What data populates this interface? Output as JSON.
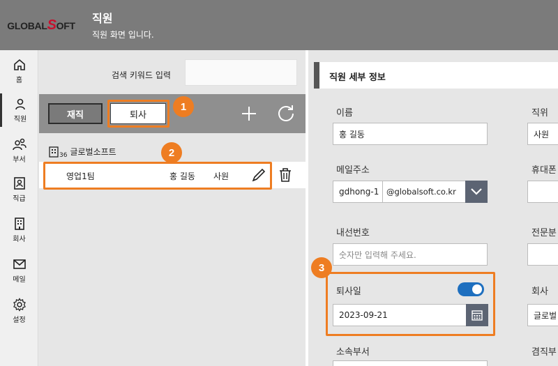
{
  "header": {
    "logo_part1": "GLOBAL",
    "logo_part2": "S",
    "logo_part3": "OFT",
    "title": "직원",
    "subtitle": "직원 화면 입니다."
  },
  "nav": {
    "items": [
      {
        "label": "홈",
        "icon": "home-icon"
      },
      {
        "label": "직원",
        "icon": "person-icon"
      },
      {
        "label": "부서",
        "icon": "people-icon"
      },
      {
        "label": "직급",
        "icon": "badge-icon"
      },
      {
        "label": "회사",
        "icon": "building-icon"
      },
      {
        "label": "메일",
        "icon": "mail-icon"
      },
      {
        "label": "설정",
        "icon": "gear-icon"
      }
    ],
    "active_index": 1
  },
  "list": {
    "search_label": "검색 키워드 입력",
    "search_value": "",
    "tab_active": "재직",
    "tab_inactive": "퇴사",
    "org": {
      "name": "글로벌소프트",
      "count": "36"
    },
    "employee": {
      "team": "영업1팀",
      "name": "홍 길동",
      "rank": "사원"
    }
  },
  "detail": {
    "title": "직원 세부 정보",
    "name_label": "이름",
    "name_value": "홍 길동",
    "position_label": "직위",
    "position_value": "사원",
    "email_label": "메일주소",
    "email_id": "gdhong-1",
    "email_domain": "@globalsoft.co.kr",
    "phone_label": "휴대폰",
    "ext_label": "내선번호",
    "ext_placeholder": "숫자만 입력해 주세요.",
    "specialty_label": "전문분",
    "retire_label": "퇴사일",
    "retire_toggle_on": true,
    "retire_date": "2023-09-21",
    "company_label": "회사",
    "company_value": "글로벌",
    "dept_label": "소속부서",
    "concurrent_label": "겸직부"
  },
  "callouts": [
    "1",
    "2",
    "3"
  ],
  "colors": {
    "header_bg": "#7b7b7b",
    "highlight": "#ee7d22",
    "toggle_on": "#1e6fbf",
    "button_dark": "#5c6473",
    "logo_red": "#c8102e"
  }
}
